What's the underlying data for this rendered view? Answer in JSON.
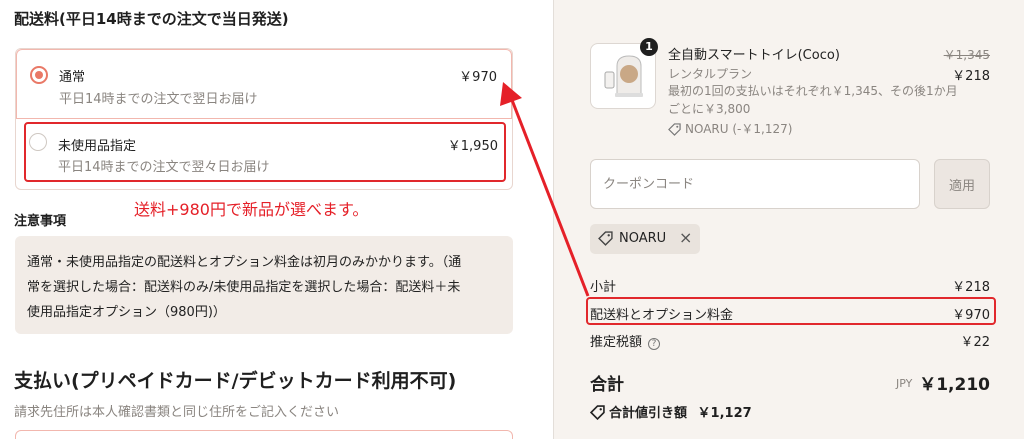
{
  "shipping": {
    "title": "配送料(平日14時までの注文で当日発送)",
    "options": [
      {
        "name": "通常",
        "desc": "平日14時までの注文で翌日お届け",
        "price": "￥970",
        "selected": true
      },
      {
        "name": "未使用品指定",
        "desc": "平日14時までの注文で翌々日お届け",
        "price": "￥1,950",
        "selected": false
      }
    ]
  },
  "annotation": {
    "note": "送料+980円で新品が選べます。",
    "color": "#e52028"
  },
  "notice": {
    "title": "注意事項",
    "lines": [
      "通常・未使用品指定の配送料とオプション料金は初月のみかかります。（通",
      "常を選択した場合：配送料のみ/未使用品指定を選択した場合：配送料＋未",
      "使用品指定オプション（980円)）"
    ]
  },
  "payment": {
    "title": "支払い(プリペイドカード/デビットカード利用不可)",
    "subtitle": "請求先住所は本人確認書類と同じ住所をご記入ください"
  },
  "order": {
    "item": {
      "qty": "1",
      "name": "全自動スマートトイレ(Coco)",
      "plan": "レンタルプラン",
      "desc": "最初の1回の支払いはそれぞれ￥1,345、その後1か月ごとに￥3,800",
      "discount": "NOARU (-￥1,127)",
      "price_original": "￥1,345",
      "price": "￥218"
    },
    "coupon": {
      "placeholder": "クーポンコード",
      "apply_label": "適用"
    },
    "applied_code": "NOARU",
    "rows": [
      {
        "label": "小計",
        "value": "￥218"
      },
      {
        "label": "配送料とオプション料金",
        "value": "￥970"
      },
      {
        "label": "推定税額",
        "value": "￥22"
      }
    ],
    "total": {
      "label": "合計",
      "currency": "JPY",
      "value": "￥1,210"
    },
    "savings": {
      "label": "合計値引き額",
      "value": "￥1,127"
    }
  },
  "colors": {
    "accent": "#e97967",
    "highlight": "#e1282c",
    "panel_bg": "#f7f3ef"
  }
}
